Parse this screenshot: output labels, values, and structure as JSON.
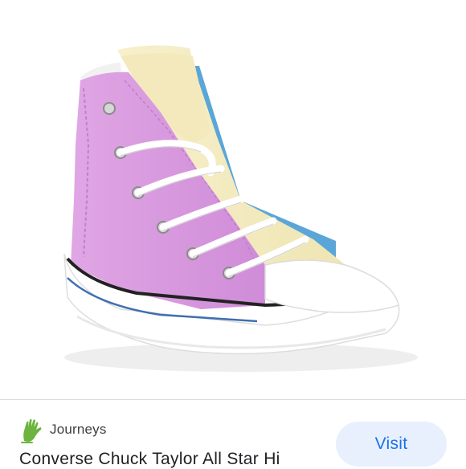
{
  "result": {
    "source_name": "Journeys",
    "title": "Converse Chuck Taylor All Star Hi",
    "visit_label": "Visit"
  },
  "product_image": {
    "colors": {
      "upper_pink": "#d99be0",
      "upper_yellow": "#f4ecc1",
      "accent_blue": "#5aa6d8",
      "sole": "#ffffff",
      "sole_stripe": "#222222"
    }
  },
  "icons": {
    "source": "journeys-hand-logo-icon"
  },
  "colors": {
    "visit_button_bg": "#e8f0fe",
    "visit_button_text": "#1a73e8",
    "logo_green": "#6cb33f"
  }
}
